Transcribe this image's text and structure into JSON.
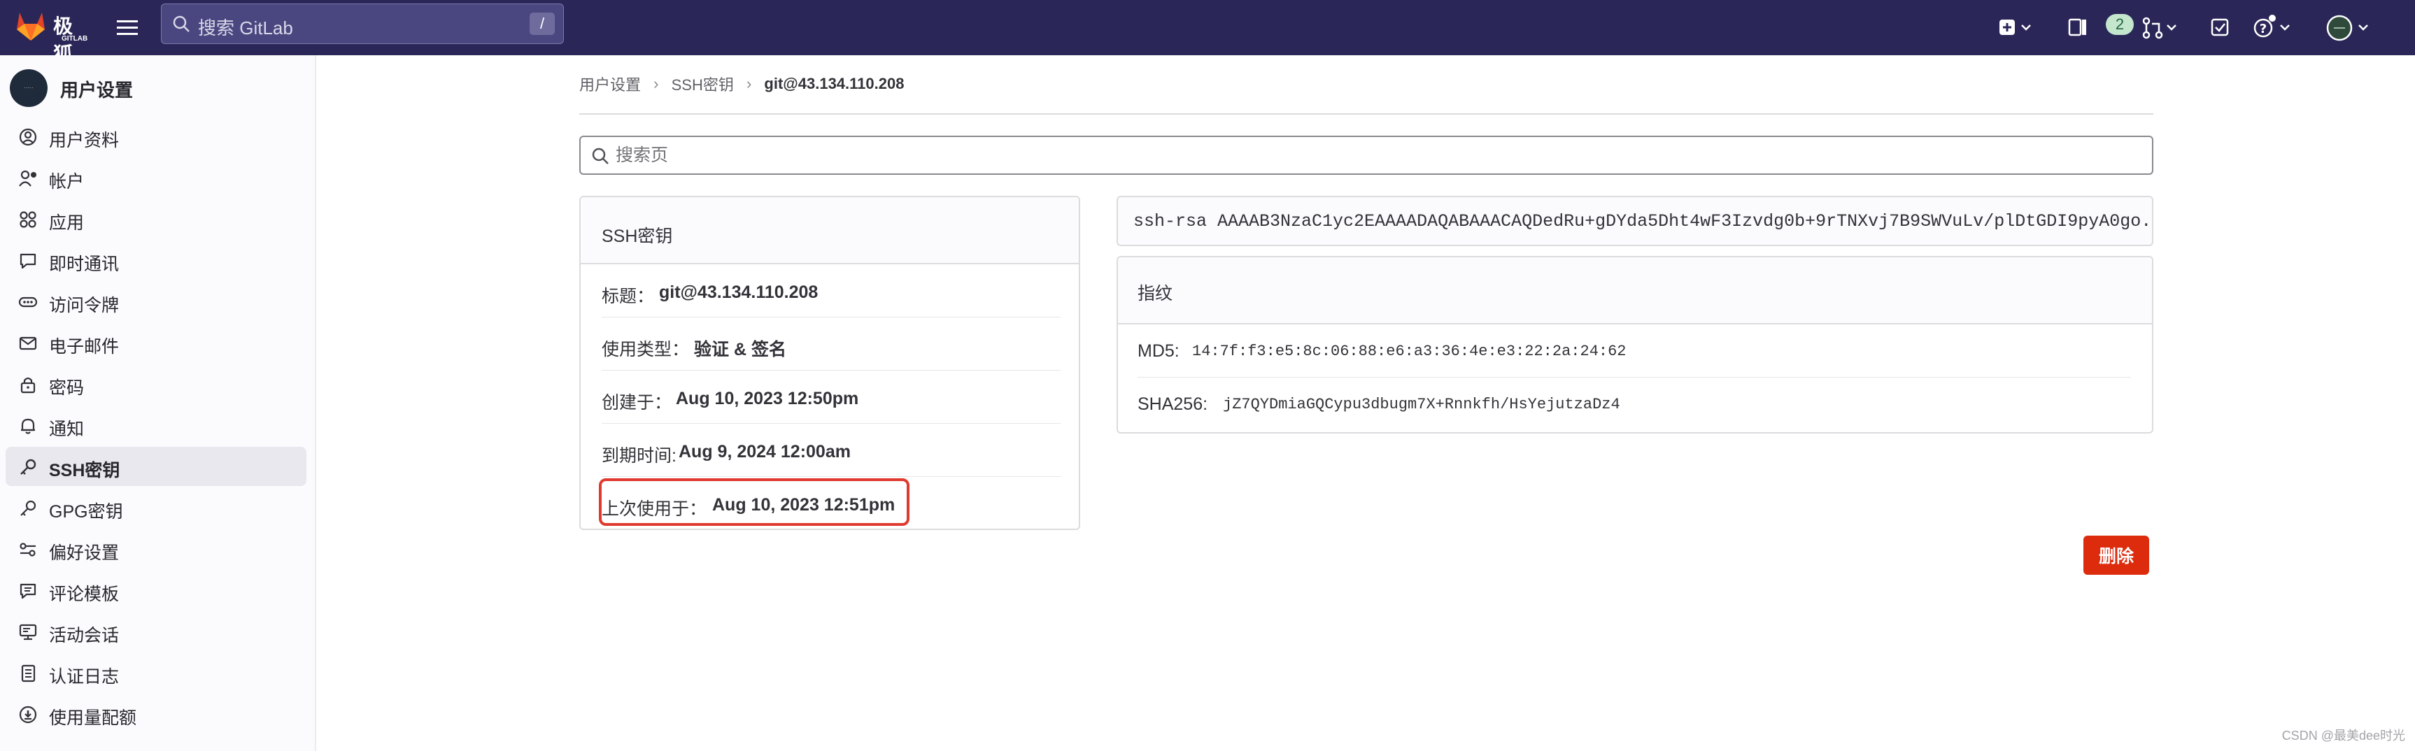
{
  "topbar": {
    "logo_text": "极狐",
    "logo_sub": "GITLAB",
    "search_placeholder": "搜索 GitLab",
    "search_shortcut": "/",
    "merge_requests_count": "2"
  },
  "sidebar": {
    "avatar_text": "·····",
    "title": "用户设置",
    "items": [
      {
        "label": "用户资料",
        "icon": "profile-icon"
      },
      {
        "label": "帐户",
        "icon": "account-icon"
      },
      {
        "label": "应用",
        "icon": "applications-icon"
      },
      {
        "label": "即时通讯",
        "icon": "chat-icon"
      },
      {
        "label": "访问令牌",
        "icon": "token-icon"
      },
      {
        "label": "电子邮件",
        "icon": "mail-icon"
      },
      {
        "label": "密码",
        "icon": "lock-icon"
      },
      {
        "label": "通知",
        "icon": "bell-icon"
      },
      {
        "label": "SSH密钥",
        "icon": "key-icon",
        "active": true
      },
      {
        "label": "GPG密钥",
        "icon": "key-icon"
      },
      {
        "label": "偏好设置",
        "icon": "preferences-icon"
      },
      {
        "label": "评论模板",
        "icon": "comment-icon"
      },
      {
        "label": "活动会话",
        "icon": "monitor-icon"
      },
      {
        "label": "认证日志",
        "icon": "log-icon"
      },
      {
        "label": "使用量配额",
        "icon": "info-icon"
      }
    ]
  },
  "breadcrumb": [
    "用户设置",
    "SSH密钥",
    "git@43.134.110.208"
  ],
  "page_search_placeholder": "搜索页",
  "ssh_card": {
    "header": "SSH密钥",
    "title_label": "标题：",
    "title_value": "git@43.134.110.208",
    "usage_label": "使用类型：",
    "usage_value": "验证 & 签名",
    "created_label": "创建于：",
    "created_value": "Aug 10, 2023 12:50pm",
    "expires_label": "到期时间:",
    "expires_value": "Aug 9, 2024 12:00am",
    "last_used_label": "上次使用于：",
    "last_used_value": "Aug 10, 2023 12:51pm"
  },
  "public_key": "ssh-rsa AAAAB3NzaC1yc2EAAAADAQABAAACAQDedRu+gDYda5Dht4wF3Izvdg0b+9rTNXvj7B9SWVuLv/plDtGDI9pyA0go...",
  "fingerprints": {
    "header": "指纹",
    "md5_label": "MD5:",
    "md5_value": "14:7f:f3:e5:8c:06:88:e6:a3:36:4e:e3:22:2a:24:62",
    "sha256_label": "SHA256:",
    "sha256_value": "jZ7QYDmiaGQCypu3dbugm7X+Rnnkfh/HsYejutzaDz4"
  },
  "delete_label": "删除",
  "watermark": "CSDN @最美dee时光",
  "colors": {
    "topbar": "#2a2758",
    "danger": "#dd2b0e",
    "highlight": "#e03a2f"
  }
}
